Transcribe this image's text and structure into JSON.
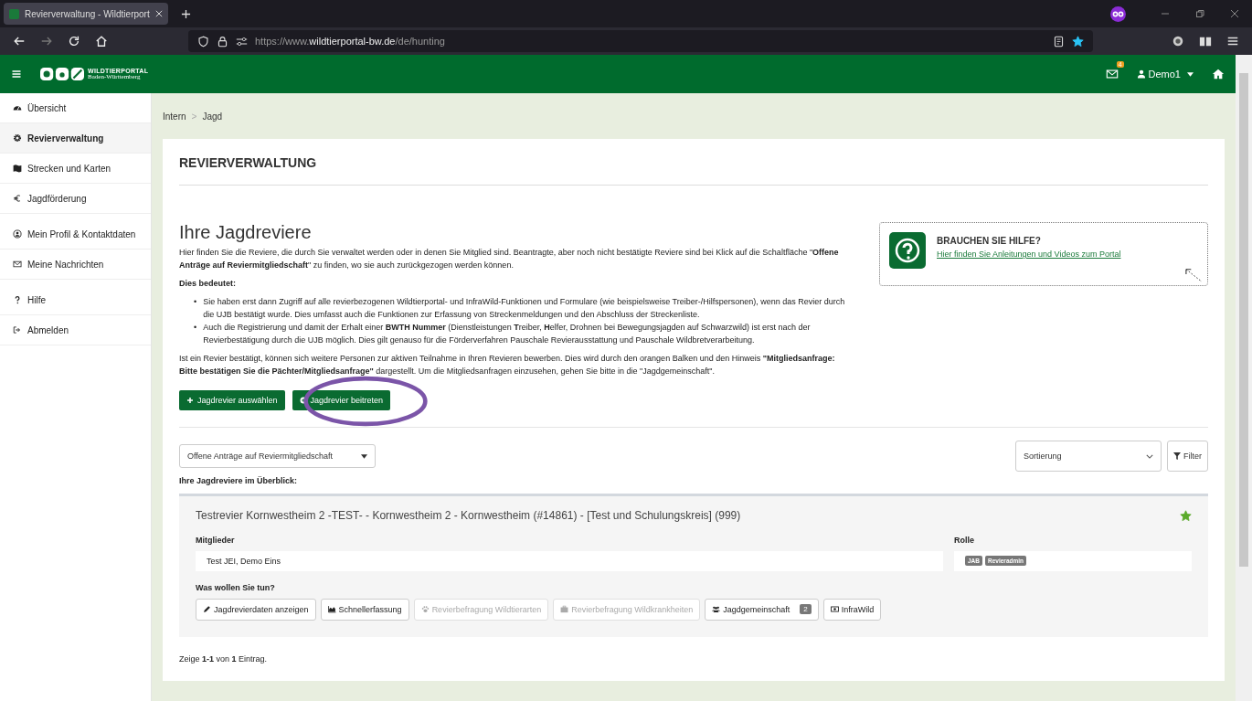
{
  "browser": {
    "tab_title": "Revierverwaltung - Wildtierport",
    "url_prefix": "https://www.",
    "url_domain": "wildtierportal-bw.de",
    "url_path": "/de/hunting",
    "bookmarked": true
  },
  "header": {
    "logo_title": "WILDTIERPORTAL",
    "logo_subtitle": "Baden-Württemberg",
    "messages_count": "4",
    "user": "Demo1"
  },
  "sidebar": {
    "items": [
      {
        "label": "Übersicht",
        "selected": false
      },
      {
        "label": "Revierverwaltung",
        "selected": true
      },
      {
        "label": "Strecken und Karten",
        "selected": false
      },
      {
        "label": "Jagdförderung",
        "selected": false
      },
      {
        "label": "Mein Profil & Kontaktdaten",
        "selected": false
      },
      {
        "label": "Meine Nachrichten",
        "selected": false
      },
      {
        "label": "Hilfe",
        "selected": false
      },
      {
        "label": "Abmelden",
        "selected": false
      }
    ]
  },
  "breadcrumb": [
    "Intern",
    "Jagd"
  ],
  "breadcrumb_separator": ">",
  "page_title": "REVIERVERWALTUNG",
  "section_title": "Ihre Jagdreviere",
  "intro": "Hier finden Sie die Reviere, die durch Sie verwaltet werden oder in denen Sie Mitglied sind. Beantragte, aber noch nicht bestätigte Reviere sind bei Klick auf die Schaltfläche \"**Offene Anträge auf Reviermitgliedschaft**\" zu finden, wo sie auch zurückgezogen werden können.",
  "meaning_title": "Dies bedeutet:",
  "bullets": [
    {
      "marker": "•",
      "text": "Sie haben erst dann Zugriff auf alle revierbezogenen Wildtierportal- und InfraWild-Funktionen und Formulare (wie beispielsweise Treiber-/Hilfspersonen), wenn das Revier durch die UJB bestätigt wurde. Dies umfasst auch die Funktionen zur Erfassung von Streckenmeldungen und den Abschluss der Streckenliste."
    },
    {
      "marker": "•",
      "text": "Auch die Registrierung und damit der Erhalt einer **BWTH Nummer** (Dienstleistungen **T**reiber, **H**elfer, Drohnen bei Bewegungsjagden auf Schwarzwild) ist erst nach der Revierbestätigung durch die UJB möglich. Dies gilt genauso für die Förderverfahren Pauschale Revierausstattung und Pauschale Wildbretverarbeitung."
    }
  ],
  "note": "Ist ein Revier bestätigt, können sich weitere Personen zur aktiven Teilnahme in Ihren Revieren bewerben. Dies wird durch den orangen Balken und den Hinweis **\"Mitgliedsanfrage: Bitte bestätigen Sie die Pächter/Mitgliedsanfrage\"** dargestellt. Um die Mitgliedsanfragen einzusehen, gehen Sie bitte in die \"Jagdgemeinschaft\".",
  "buttons": [
    "Jagdrevier auswählen",
    "Jagdrevier beitreten"
  ],
  "help": {
    "title": "BRAUCHEN SIE HILFE?",
    "link": "Hier finden Sie Anleitungen und Videos zum Portal"
  },
  "filter_dropdown": "Offene Anträge auf Reviermitgliedschaft",
  "sort_select": "Sortierung",
  "filter_button": "Filter",
  "overview_label": "Ihre Jagdreviere im Überblick:",
  "revier": {
    "title": "Testrevier Kornwestheim 2 -TEST- - Kornwestheim 2 - Kornwestheim (#14861) - [Test und Schulungskreis] (999)",
    "favorite": true,
    "members_label": "Mitglieder",
    "members": "Test JEI, Demo Eins",
    "role_label": "Rolle",
    "roles": [
      "JAB",
      "Revieradmin"
    ],
    "actions_label": "Was wollen Sie tun?",
    "actions": [
      {
        "label": "Jagdrevierdaten anzeigen",
        "disabled": false
      },
      {
        "label": "Schnellerfassung",
        "disabled": false
      },
      {
        "label": "Revierbefragung Wildtierarten",
        "disabled": true
      },
      {
        "label": "Revierbefragung Wildkrankheiten",
        "disabled": true
      },
      {
        "label": "Jagdgemeinschaft",
        "disabled": false,
        "count": "2"
      },
      {
        "label": "InfraWild",
        "disabled": false
      }
    ]
  },
  "pagination": "Zeige **1-1** von **1** Eintrag."
}
